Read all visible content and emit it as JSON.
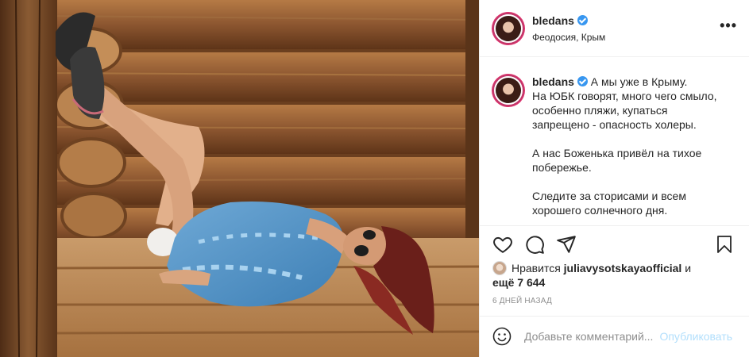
{
  "post": {
    "username": "bledans",
    "location": "Феодосия, Крым",
    "more_label": "•••"
  },
  "caption": {
    "username": "bledans",
    "lines": [
      "А мы уже в Крыму.",
      "На ЮБК говорят, много чего смыло,",
      "особенно пляжи, купаться",
      "запрещено - опасность холеры.",
      "",
      "А нас Боженька привёл на тихое",
      "побережье.",
      "",
      "Следите за сторисами и всем",
      "хорошего солнечного дня."
    ]
  },
  "likes": {
    "prefix": "Нравится",
    "user": "juliavysotskayaofficial",
    "joiner": "и",
    "others": "ещё 7 644"
  },
  "time_ago": "6 ДНЕЙ НАЗАД",
  "comment": {
    "placeholder": "Добавьте комментарий...",
    "publish_label": "Опубликовать"
  },
  "icons": {
    "like": "heart-icon",
    "comment": "comment-icon",
    "share": "paper-plane-icon",
    "save": "bookmark-icon",
    "emoji": "smiley-icon",
    "verified": "verified-badge-icon"
  },
  "colors": {
    "verified": "#3897f0",
    "publish_disabled": "#b2dffc",
    "muted_text": "#8e8e8e",
    "divider": "#efefef"
  }
}
